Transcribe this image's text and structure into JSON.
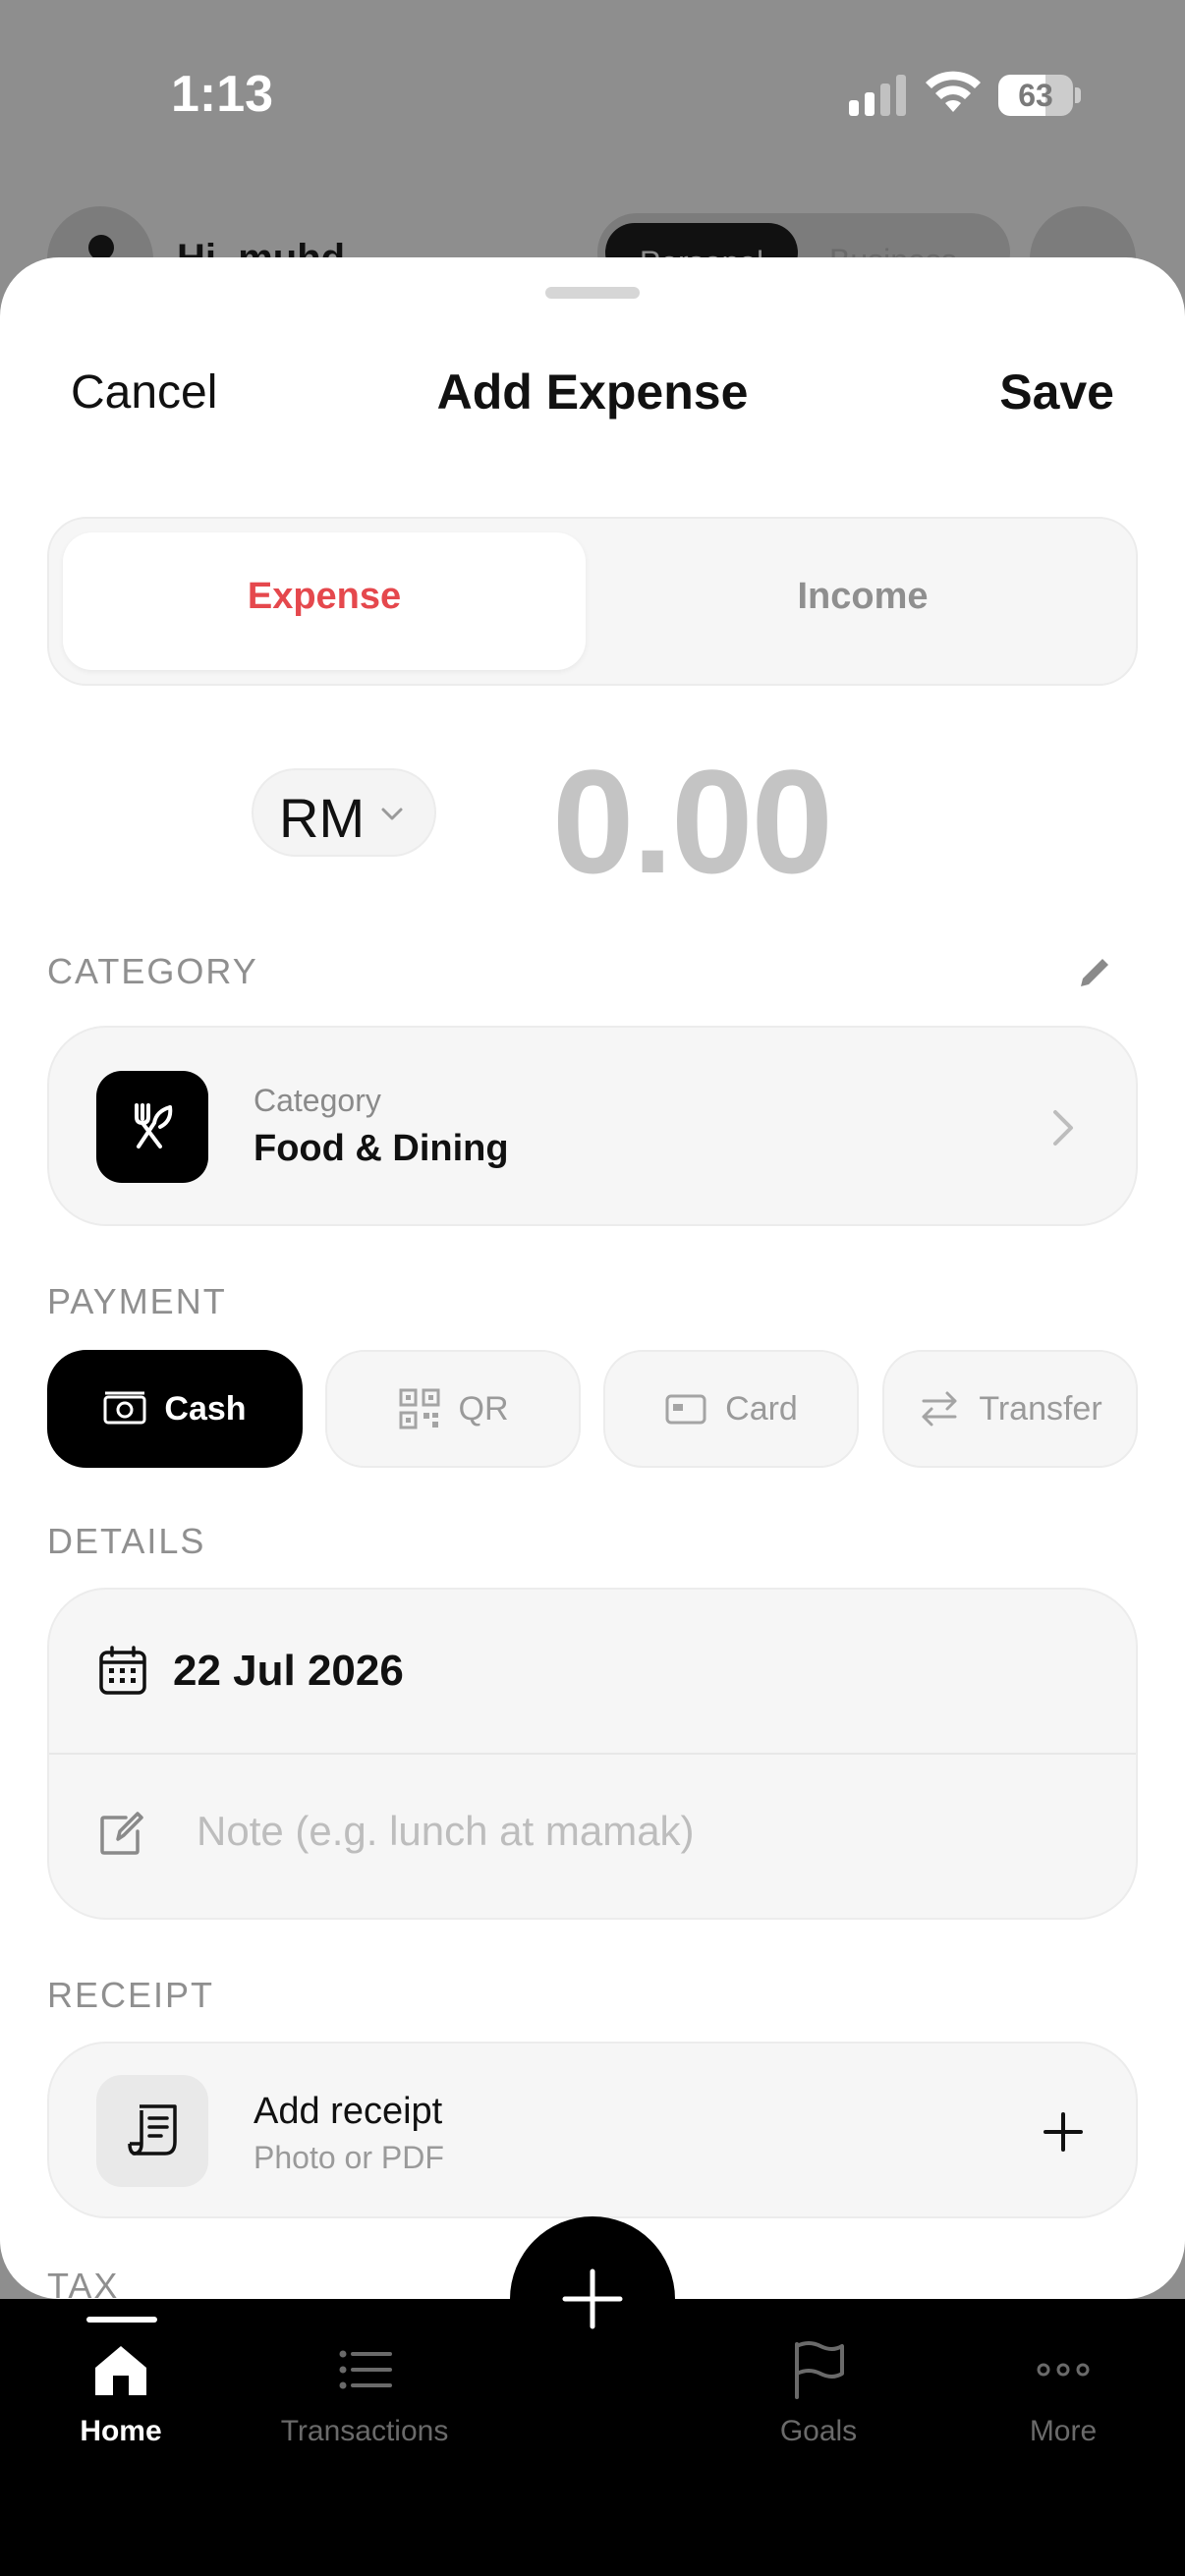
{
  "status_bar": {
    "time": "1:13",
    "battery": "63",
    "battery_level": 0.63
  },
  "background": {
    "greeting": "Hi, muhd",
    "toggle_active": "Personal",
    "toggle_inactive": "Business"
  },
  "sheet": {
    "cancel_label": "Cancel",
    "title": "Add Expense",
    "save_label": "Save"
  },
  "type_segment": {
    "expense_label": "Expense",
    "income_label": "Income",
    "selected": "Expense"
  },
  "amount": {
    "currency": "RM",
    "value": "0.00"
  },
  "category_section": {
    "label": "CATEGORY",
    "small_label": "Category",
    "value": "Food & Dining",
    "icon": "utensils-icon"
  },
  "payment_section": {
    "label": "PAYMENT",
    "options": [
      {
        "label": "Cash",
        "icon": "cash-icon",
        "selected": true
      },
      {
        "label": "QR",
        "icon": "qr-icon",
        "selected": false
      },
      {
        "label": "Card",
        "icon": "card-icon",
        "selected": false
      },
      {
        "label": "Transfer",
        "icon": "transfer-icon",
        "selected": false
      }
    ]
  },
  "details_section": {
    "label": "DETAILS",
    "date": "22 Jul 2026",
    "note_placeholder": "Note (e.g. lunch at mamak)",
    "note_value": ""
  },
  "receipt_section": {
    "label": "RECEIPT",
    "title": "Add receipt",
    "subtitle": "Photo or PDF"
  },
  "tax_section": {
    "label": "TAX"
  },
  "tabbar": {
    "items": [
      {
        "label": "Home",
        "icon": "home-icon",
        "active": true
      },
      {
        "label": "Transactions",
        "icon": "list-icon",
        "active": false
      },
      {
        "label": "Goals",
        "icon": "flag-icon",
        "active": false
      },
      {
        "label": "More",
        "icon": "more-icon",
        "active": false
      }
    ],
    "fab_icon": "plus-icon"
  },
  "colors": {
    "accent_expense": "#e5484d",
    "primary": "#000000",
    "muted": "#8f8f8f"
  }
}
